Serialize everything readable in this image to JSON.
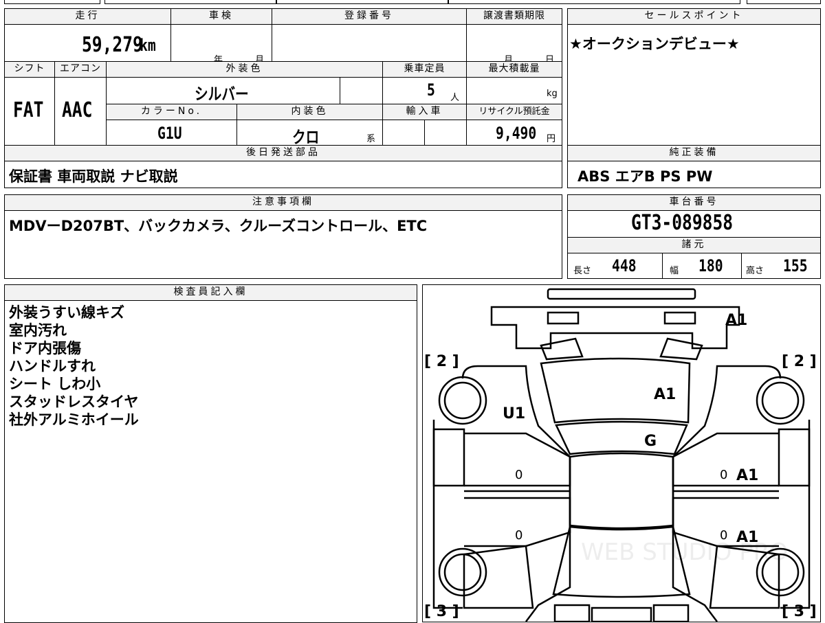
{
  "top_fragment": "…",
  "vehicle": {
    "mileage_label": "走行",
    "mileage": "59,279",
    "mileage_unit": "km",
    "inspection_label": "車検",
    "inspection_year_unit": "年",
    "inspection_month_unit": "月",
    "registration_label": "登録番号",
    "transfer_label": "譲渡書類期限",
    "transfer_month_unit": "月",
    "transfer_day_unit": "日",
    "shift_label": "シフト",
    "shift": "FAT",
    "aircon_label": "エアコン",
    "aircon": "AAC",
    "exterior_label": "外装色",
    "exterior": "シルバー",
    "capacity_label": "乗車定員",
    "capacity": "5",
    "capacity_unit": "人",
    "maxload_label": "最大積載量",
    "maxload_unit": "kg",
    "colorno_label": "カラーNo.",
    "colorno": "G1U",
    "interior_label": "内装色",
    "interior": "クロ",
    "interior_unit": "系",
    "import_label": "輸入車",
    "recycle_label": "リサイクル預託金",
    "recycle": "9,490",
    "recycle_unit": "円",
    "later_parts_label": "後日発送部品",
    "later_parts": "保証書 車両取説 ナビ取説"
  },
  "sales_point": {
    "label": "セールスポイント",
    "text": "★オークションデビュー★"
  },
  "genuine": {
    "label": "純正装備",
    "text": "ABS エアB PS PW"
  },
  "notes": {
    "label": "注意事項欄",
    "text": "MDVーD207BT、バックカメラ、クルーズコントロール、ETC"
  },
  "chassis": {
    "label": "車台番号",
    "number": "GT3-089858",
    "specs_label": "諸元",
    "length_label": "長さ",
    "length": "448",
    "width_label": "幅",
    "width": "180",
    "height_label": "高さ",
    "height": "155"
  },
  "inspector": {
    "label": "検査員記入欄",
    "items": [
      "外装うすい線キズ",
      "室内汚れ",
      "ドア内張傷",
      "ハンドルすれ",
      "シート しわ小",
      "スタッドレスタイヤ",
      "社外アルミホイール"
    ]
  },
  "diagram": {
    "marks": {
      "front_roof": "A1",
      "hood": "A1",
      "left_front": "U1",
      "windshield": "G",
      "right_front_door": "A1",
      "right_rear_door": "A1"
    },
    "door_zeros": [
      "0",
      "0",
      "0",
      "0"
    ],
    "tire_tread": {
      "front_left": "[ 2 ]",
      "front_right": "[ 2 ]",
      "rear_left": "[ 3 ]",
      "rear_right": "[ 3 ]"
    },
    "watermark": "WEB STUDIO PRO"
  }
}
